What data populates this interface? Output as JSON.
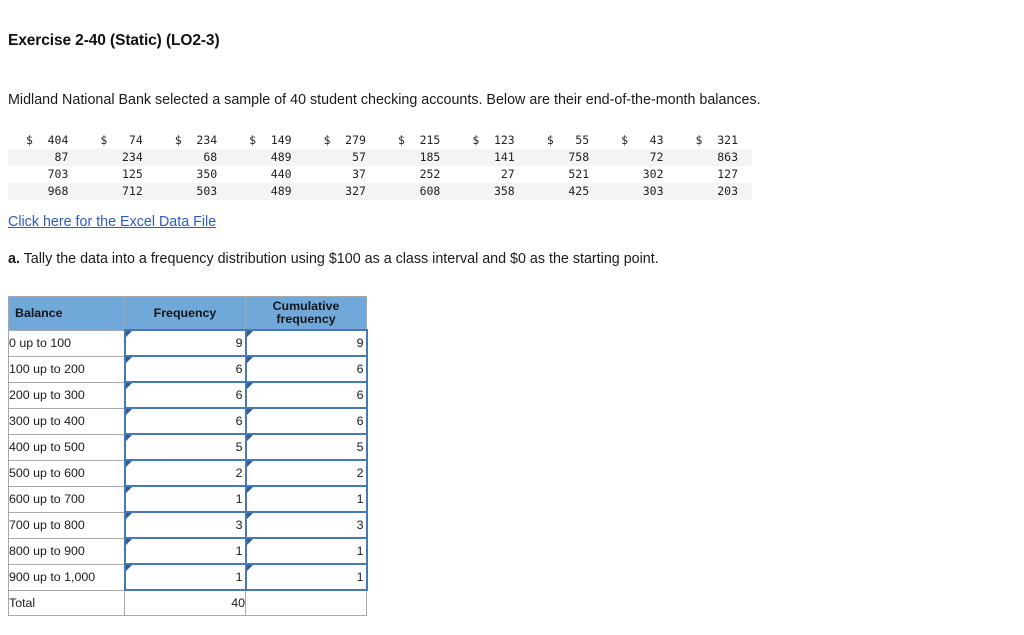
{
  "exercise": {
    "title": "Exercise 2-40 (Static) (LO2-3)",
    "intro": "Midland National Bank selected a sample of 40 student checking accounts. Below are their end-of-the-month balances.",
    "excel_link_label": "Click here for the Excel Data File",
    "question_a_label": "a.",
    "question_a_text": "Tally the data into a frequency distribution using $100 as a class interval and $0 as the starting point."
  },
  "balances_grid": {
    "currency_symbol": "$",
    "rows": [
      [
        "404",
        "74",
        "234",
        "149",
        "279",
        "215",
        "123",
        "55",
        "43",
        "321"
      ],
      [
        "87",
        "234",
        "68",
        "489",
        "57",
        "185",
        "141",
        "758",
        "72",
        "863"
      ],
      [
        "703",
        "125",
        "350",
        "440",
        "37",
        "252",
        "27",
        "521",
        "302",
        "127"
      ],
      [
        "968",
        "712",
        "503",
        "489",
        "327",
        "608",
        "358",
        "425",
        "303",
        "203"
      ]
    ]
  },
  "freq_table": {
    "headers": {
      "balance": "Balance",
      "frequency": "Frequency",
      "cumulative_line1": "Cumulative",
      "cumulative_line2": "frequency"
    },
    "rows": [
      {
        "balance": "0 up to 100",
        "frequency": "9",
        "cumulative": "9"
      },
      {
        "balance": "100 up to 200",
        "frequency": "6",
        "cumulative": "6"
      },
      {
        "balance": "200 up to 300",
        "frequency": "6",
        "cumulative": "6"
      },
      {
        "balance": "300 up to 400",
        "frequency": "6",
        "cumulative": "6"
      },
      {
        "balance": "400 up to 500",
        "frequency": "5",
        "cumulative": "5"
      },
      {
        "balance": "500 up to 600",
        "frequency": "2",
        "cumulative": "2"
      },
      {
        "balance": "600 up to 700",
        "frequency": "1",
        "cumulative": "1"
      },
      {
        "balance": "700 up to 800",
        "frequency": "3",
        "cumulative": "3"
      },
      {
        "balance": "800 up to 900",
        "frequency": "1",
        "cumulative": "1"
      },
      {
        "balance": "900 up to 1,000",
        "frequency": "1",
        "cumulative": "1"
      }
    ],
    "total": {
      "label": "Total",
      "frequency": "40",
      "cumulative": ""
    }
  },
  "colors": {
    "header_blue": "#70a8da",
    "input_border_blue": "#4779b4",
    "link_blue": "#2b5cc4",
    "stripe_gray": "#f4f4f4"
  }
}
